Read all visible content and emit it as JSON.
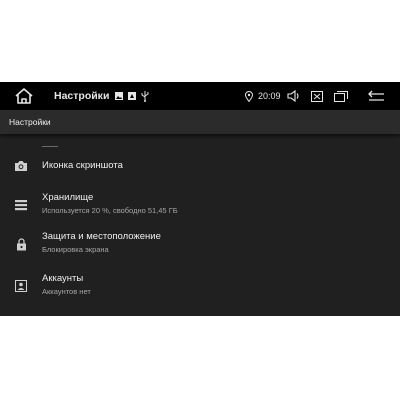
{
  "statusbar": {
    "home_icon": "home-outline-icon",
    "title": "Настройки",
    "notification_icons": [
      "image-icon",
      "screenshot-icon",
      "usb-icon"
    ],
    "location_icon": "location-pin-icon",
    "time": "20:09",
    "actions": [
      "volume-icon",
      "close-box-icon",
      "recent-apps-icon",
      "back-arrow-icon"
    ]
  },
  "header": {
    "title": "Настройки"
  },
  "items": [
    {
      "icon": "camera-icon",
      "title": "Иконка скриншота",
      "subtitle": ""
    },
    {
      "icon": "storage-icon",
      "title": "Хранилище",
      "subtitle": "Используется 20 %, свободно 51,45 ГБ"
    },
    {
      "icon": "lock-icon",
      "title": "Защита и местоположение",
      "subtitle": "Блокировка экрана"
    },
    {
      "icon": "account-icon",
      "title": "Аккаунты",
      "subtitle": "Аккаунтов нет"
    }
  ],
  "colors": {
    "statusbar": "#000000",
    "header": "#2b2b2b",
    "background": "#202020",
    "text": "#efefef",
    "subtext": "#a6a6a6"
  }
}
